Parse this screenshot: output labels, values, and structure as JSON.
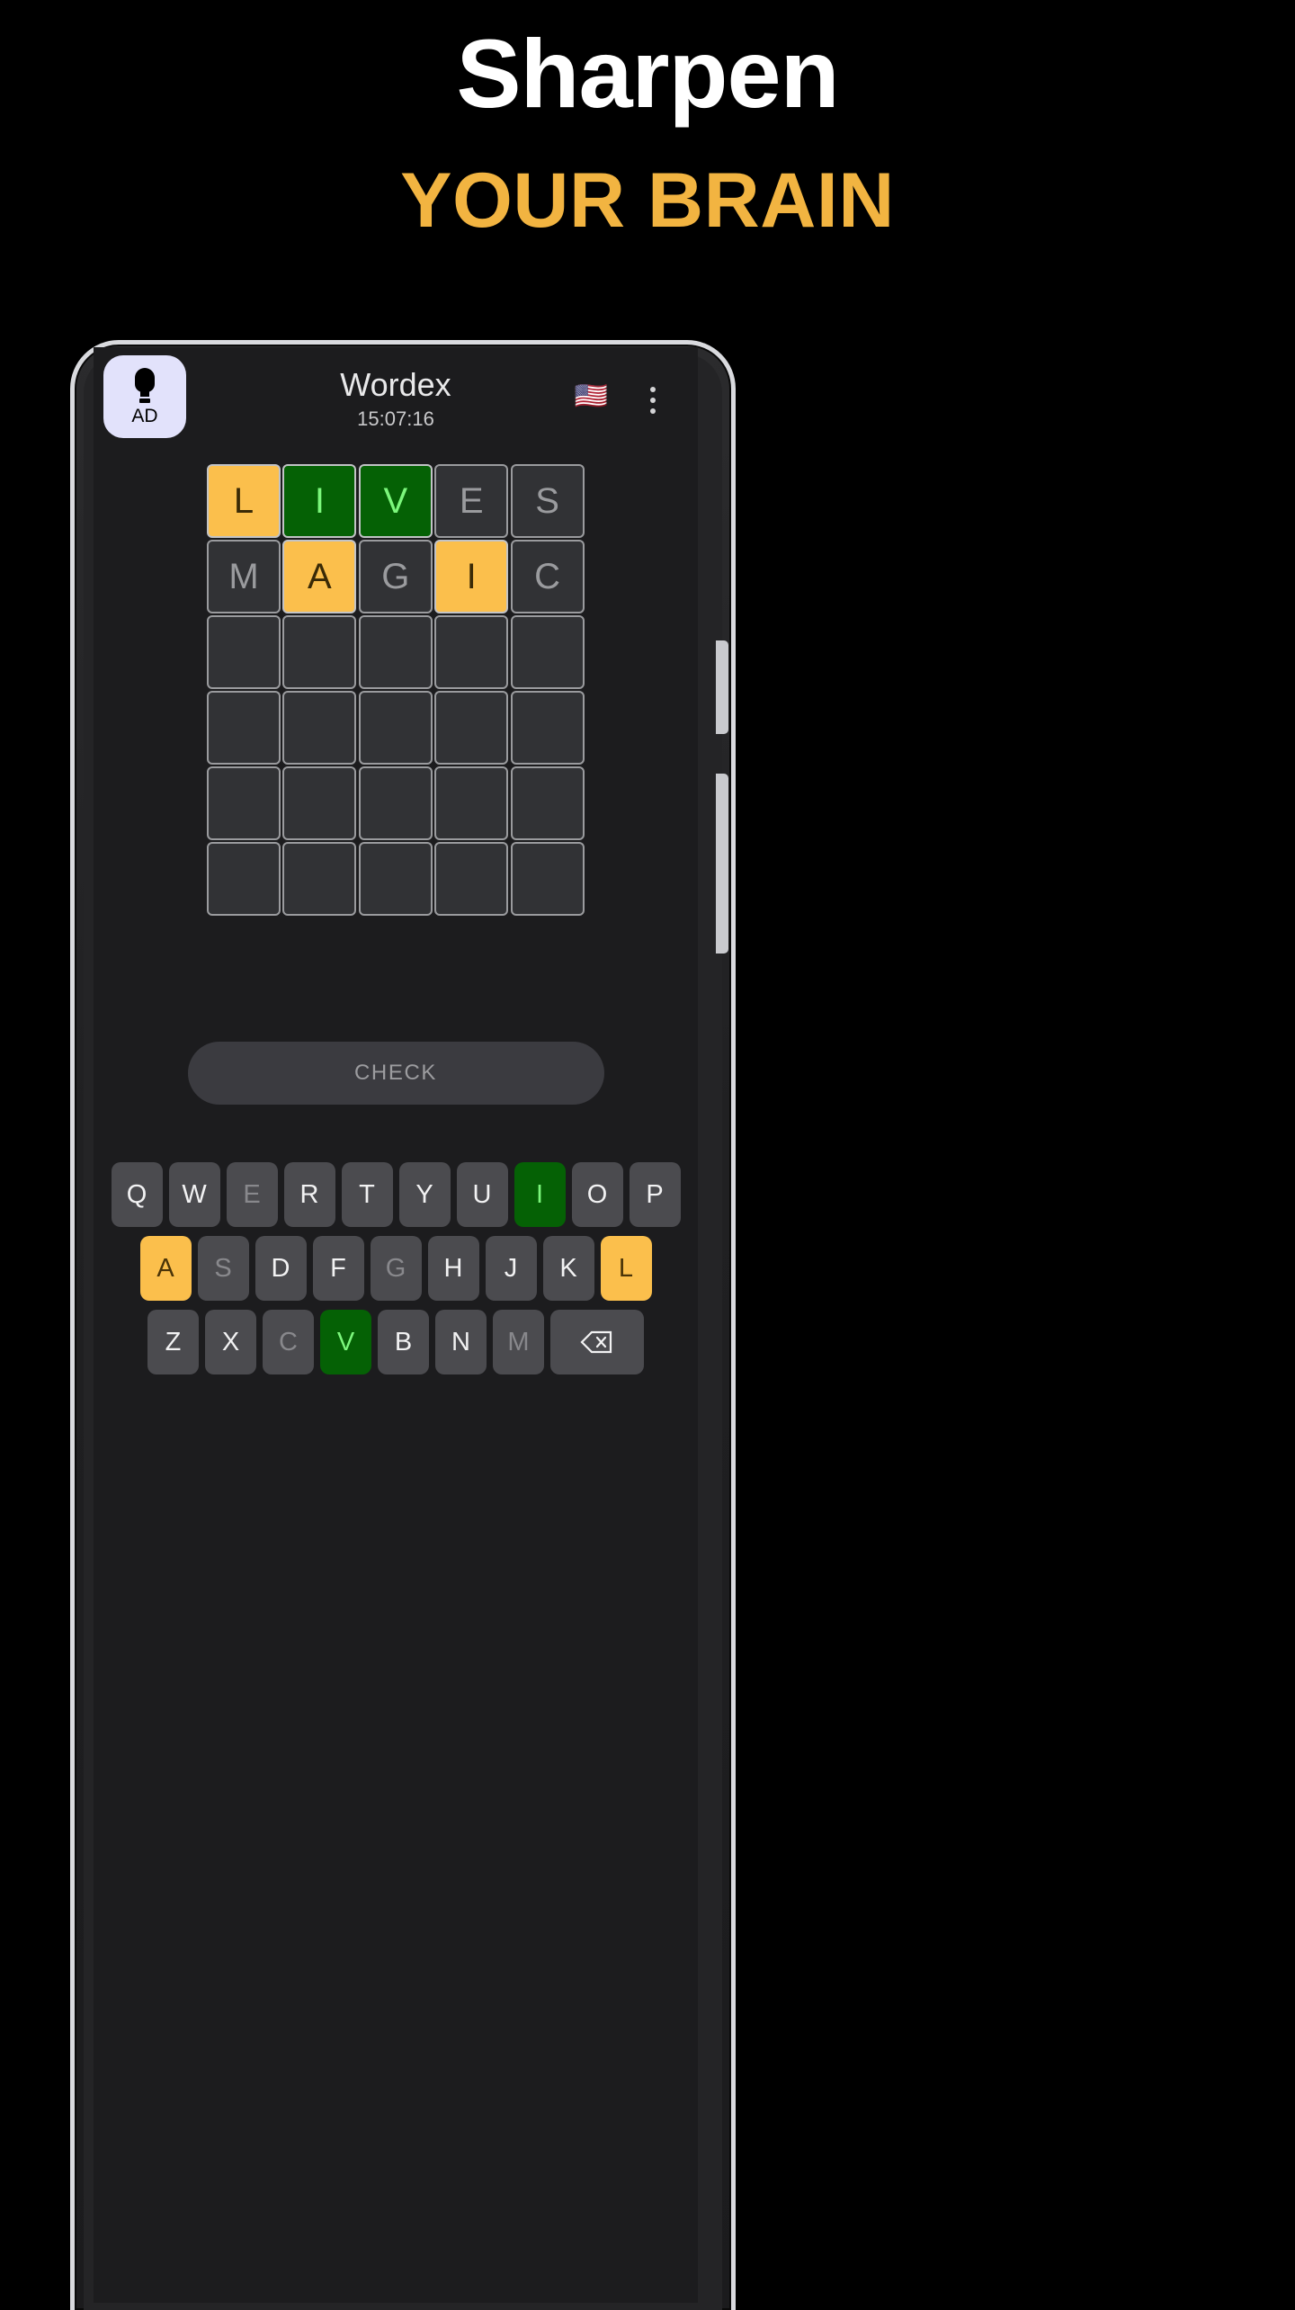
{
  "promo": {
    "line1": "Sharpen",
    "line2": "YOUR BRAIN",
    "line1_color": "#FFFFFF",
    "line2_color": "#F2B441",
    "background": "#000000"
  },
  "app": {
    "title": "Wordex",
    "timer": "15:07:16",
    "screen_background": "#1C1C1E",
    "ad_button": {
      "label": "AD",
      "icon": "lightbulb-icon",
      "background": "#E2E2FB"
    },
    "language_flag": "🇺🇸",
    "menu_icon": "more-vertical-icon"
  },
  "grid": {
    "rows": 6,
    "cols": 5,
    "colors": {
      "correct": "#056105",
      "present": "#FBBF4C",
      "absent": "#313235"
    },
    "cells": [
      [
        {
          "letter": "L",
          "state": "present"
        },
        {
          "letter": "I",
          "state": "correct"
        },
        {
          "letter": "V",
          "state": "correct"
        },
        {
          "letter": "E",
          "state": "absent"
        },
        {
          "letter": "S",
          "state": "absent"
        }
      ],
      [
        {
          "letter": "M",
          "state": "absent"
        },
        {
          "letter": "A",
          "state": "present"
        },
        {
          "letter": "G",
          "state": "absent"
        },
        {
          "letter": "I",
          "state": "present"
        },
        {
          "letter": "C",
          "state": "absent"
        }
      ],
      [
        {
          "letter": "",
          "state": "empty"
        },
        {
          "letter": "",
          "state": "empty"
        },
        {
          "letter": "",
          "state": "empty"
        },
        {
          "letter": "",
          "state": "empty"
        },
        {
          "letter": "",
          "state": "empty"
        }
      ],
      [
        {
          "letter": "",
          "state": "empty"
        },
        {
          "letter": "",
          "state": "empty"
        },
        {
          "letter": "",
          "state": "empty"
        },
        {
          "letter": "",
          "state": "empty"
        },
        {
          "letter": "",
          "state": "empty"
        }
      ],
      [
        {
          "letter": "",
          "state": "empty"
        },
        {
          "letter": "",
          "state": "empty"
        },
        {
          "letter": "",
          "state": "empty"
        },
        {
          "letter": "",
          "state": "empty"
        },
        {
          "letter": "",
          "state": "empty"
        }
      ],
      [
        {
          "letter": "",
          "state": "empty"
        },
        {
          "letter": "",
          "state": "empty"
        },
        {
          "letter": "",
          "state": "empty"
        },
        {
          "letter": "",
          "state": "empty"
        },
        {
          "letter": "",
          "state": "empty"
        }
      ]
    ]
  },
  "check_button": {
    "label": "CHECK"
  },
  "keyboard": {
    "rows": [
      [
        {
          "key": "Q",
          "state": "unused"
        },
        {
          "key": "W",
          "state": "unused"
        },
        {
          "key": "E",
          "state": "absent"
        },
        {
          "key": "R",
          "state": "unused"
        },
        {
          "key": "T",
          "state": "unused"
        },
        {
          "key": "Y",
          "state": "unused"
        },
        {
          "key": "U",
          "state": "unused"
        },
        {
          "key": "I",
          "state": "correct"
        },
        {
          "key": "O",
          "state": "unused"
        },
        {
          "key": "P",
          "state": "unused"
        }
      ],
      [
        {
          "key": "A",
          "state": "present"
        },
        {
          "key": "S",
          "state": "absent"
        },
        {
          "key": "D",
          "state": "unused"
        },
        {
          "key": "F",
          "state": "unused"
        },
        {
          "key": "G",
          "state": "absent"
        },
        {
          "key": "H",
          "state": "unused"
        },
        {
          "key": "J",
          "state": "unused"
        },
        {
          "key": "K",
          "state": "unused"
        },
        {
          "key": "L",
          "state": "present"
        }
      ],
      [
        {
          "key": "Z",
          "state": "unused"
        },
        {
          "key": "X",
          "state": "unused"
        },
        {
          "key": "C",
          "state": "absent"
        },
        {
          "key": "V",
          "state": "correct"
        },
        {
          "key": "B",
          "state": "unused"
        },
        {
          "key": "N",
          "state": "unused"
        },
        {
          "key": "M",
          "state": "absent"
        },
        {
          "key": "⌫",
          "state": "backspace"
        }
      ]
    ]
  }
}
